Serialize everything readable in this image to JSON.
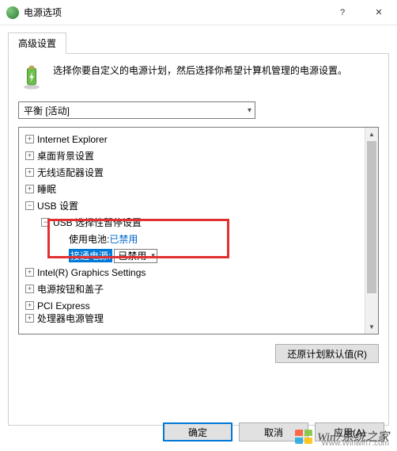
{
  "window": {
    "title": "电源选项",
    "help_label": "?",
    "close_label": "✕"
  },
  "tab": {
    "label": "高级设置"
  },
  "header": {
    "text": "选择你要自定义的电源计划，然后选择你希望计算机管理的电源设置。"
  },
  "plan_select": {
    "value": "平衡 [活动]"
  },
  "tree": {
    "items": [
      {
        "label": "Internet Explorer",
        "exp": "+",
        "lvl": 1
      },
      {
        "label": "桌面背景设置",
        "exp": "+",
        "lvl": 1
      },
      {
        "label": "无线适配器设置",
        "exp": "+",
        "lvl": 1
      },
      {
        "label": "睡眠",
        "exp": "+",
        "lvl": 1
      },
      {
        "label": "USB 设置",
        "exp": "-",
        "lvl": 1
      },
      {
        "label": "USB 选择性暂停设置",
        "exp": "-",
        "lvl": 2
      },
      {
        "label": "使用电池:",
        "value": "已禁用",
        "lvl": 3,
        "link": true
      },
      {
        "label": "接通电源:",
        "value": "已禁用",
        "lvl": 3,
        "select": true,
        "selected": true
      },
      {
        "label": "Intel(R) Graphics Settings",
        "exp": "+",
        "lvl": 1
      },
      {
        "label": "电源按钮和盖子",
        "exp": "+",
        "lvl": 1
      },
      {
        "label": "PCI Express",
        "exp": "+",
        "lvl": 1
      },
      {
        "label": "处理器电源管理",
        "exp": "+",
        "lvl": 1,
        "cut": true
      }
    ]
  },
  "buttons": {
    "restore": "还原计划默认值(R)",
    "ok": "确定",
    "cancel": "取消",
    "apply": "应用(A)"
  },
  "watermark": {
    "brand": "Win7系统之家",
    "url": "Www.Winwin7.com"
  }
}
